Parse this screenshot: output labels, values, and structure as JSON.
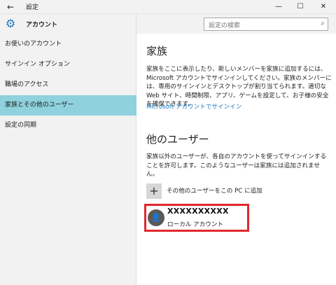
{
  "window": {
    "title": "設定",
    "back_icon": "←",
    "minimize_icon": "—",
    "maximize_icon": "☐",
    "close_icon": "✕"
  },
  "app": {
    "title": "アカウント",
    "gear_icon": "⚙"
  },
  "search": {
    "placeholder": "設定の検索",
    "icon": "⌕"
  },
  "sidebar": {
    "items": [
      {
        "label": "お使いのアカウント",
        "active": false
      },
      {
        "label": "サインイン オプション",
        "active": false
      },
      {
        "label": "職場のアクセス",
        "active": false
      },
      {
        "label": "家族とその他のユーザー",
        "active": true
      },
      {
        "label": "設定の同期",
        "active": false
      }
    ]
  },
  "family": {
    "heading": "家族",
    "description": "家族をここに表示したり、新しいメンバーを家族に追加するには、Microsoft アカウントでサインインしてください。家族のメンバーには、専用のサインインとデスクトップが割り当てられます。適切な Web サイト、時間制限、アプリ、ゲームを設定して、お子様の安全を確保できます。",
    "link": "Microsoft アカウントでサインイン"
  },
  "other_users": {
    "heading": "他のユーザー",
    "description": "家族以外のユーザーが、各自のアカウントを使ってサインインすることを許可します。このようなユーザーは家族には追加されません。",
    "add_label": "その他のユーザーをこの PC に追加",
    "add_icon": "+",
    "user": {
      "name": "XXXXXXXXXX",
      "type": "ローカル アカウント",
      "avatar_icon": "👤"
    }
  },
  "colors": {
    "accent": "#1e7bbd",
    "active_nav": "#8fd1dc",
    "highlight_border": "#e0282e"
  }
}
